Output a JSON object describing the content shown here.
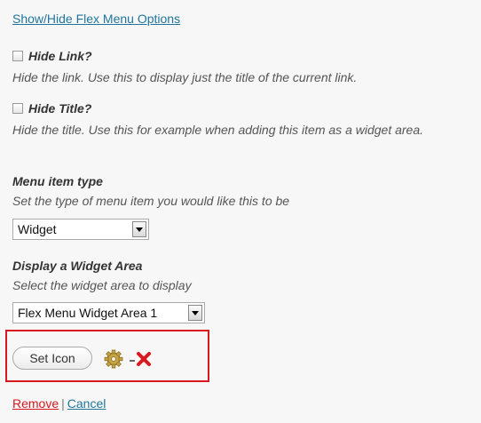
{
  "toggle_link": "Show/Hide Flex Menu Options",
  "options": [
    {
      "title": "Hide Link?",
      "description": "Hide the link. Use this to display just the title of the current link.",
      "checked": false
    },
    {
      "title": "Hide Title?",
      "description": "Hide the title. Use this for example when adding this item as a widget area.",
      "checked": false
    }
  ],
  "menu_item_type": {
    "title": "Menu item type",
    "description": "Set the type of menu item you would like this to be",
    "selected": "Widget"
  },
  "widget_area": {
    "title": "Display a Widget Area",
    "description": "Select the widget area to display",
    "selected": "Flex Menu Widget Area 1"
  },
  "icon_controls": {
    "set_icon_label": "Set Icon",
    "gear_icon": "gear-icon",
    "remove_icon": "close-icon"
  },
  "footer": {
    "remove_label": "Remove",
    "separator": "|",
    "cancel_label": "Cancel"
  },
  "colors": {
    "link": "#21759b",
    "remove": "#d9181f",
    "highlight_border": "#d9181f"
  }
}
